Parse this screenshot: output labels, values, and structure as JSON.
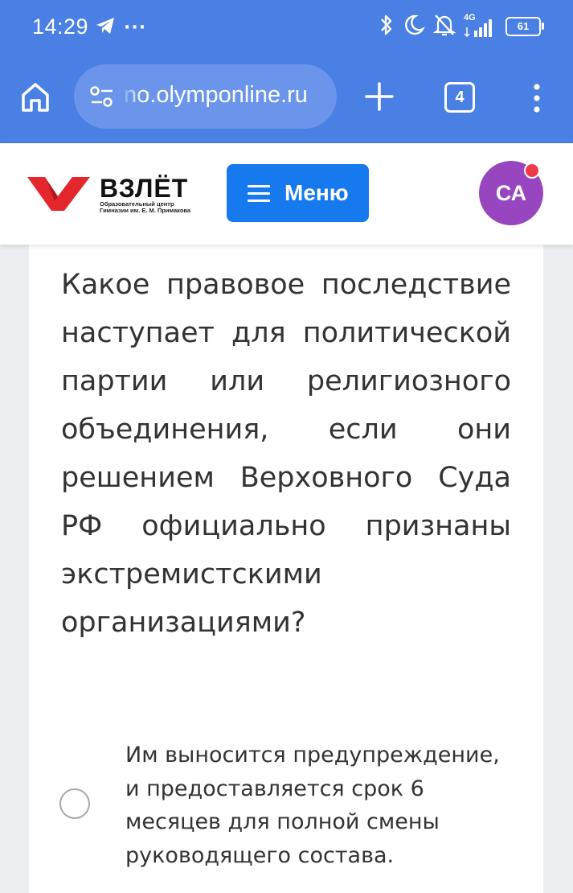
{
  "status_bar": {
    "time": "14:29",
    "ellipsis": "···",
    "network_label": "4G",
    "battery": "61",
    "icons": [
      "telegram-icon",
      "bluetooth-icon",
      "do-not-disturb-icon",
      "bell-off-icon",
      "signal-icon",
      "battery-icon"
    ]
  },
  "browser": {
    "url": "no.olymponline.ru",
    "tab_count": "4",
    "icons": [
      "home-icon",
      "site-settings-icon",
      "plus-icon",
      "kebab-menu-icon"
    ]
  },
  "site": {
    "logo_title": "ВЗЛЁТ",
    "logo_subtitle_line1": "Образовательный центр",
    "logo_subtitle_line2": "Гимназии им. Е. М. Примакова",
    "menu_label": "Меню",
    "avatar_initials": "СА",
    "colors": {
      "accent": "#1679ee",
      "avatar": "#9845c0",
      "logo_red": "#e4262d",
      "notification": "#f03a4a"
    }
  },
  "quiz": {
    "question": "Какое правовое последствие наступает для политической партии или религиозного объединения, если они решением Верховного Суда РФ официально признаны экстремистскими организациями?",
    "options": [
      {
        "text": "Им выносится предупреждение, и предоставляется срок 6 месяцев для полной смены руководящего состава.",
        "selected": false
      }
    ]
  }
}
